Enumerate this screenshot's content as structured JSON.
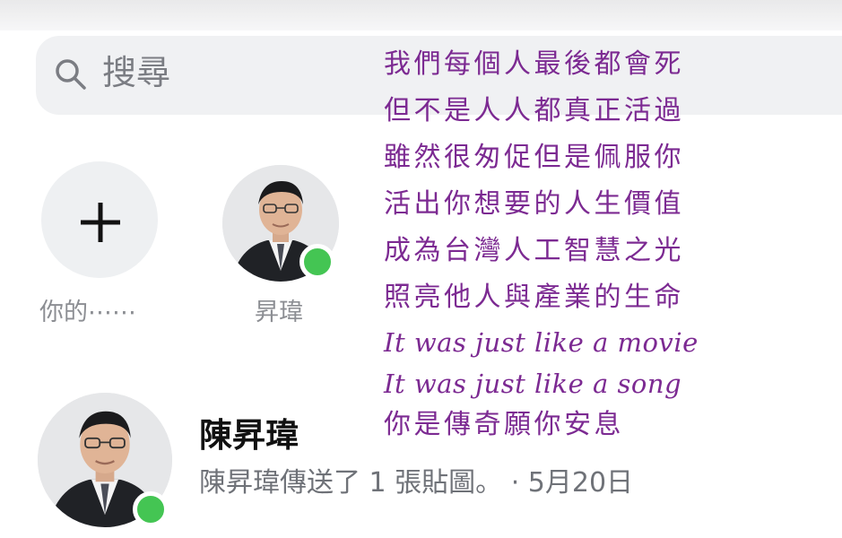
{
  "search": {
    "placeholder": "搜尋",
    "icon": "search-icon"
  },
  "stories": [
    {
      "label": "你的⋯⋯",
      "icon": "plus-icon"
    },
    {
      "label": "昇瑋",
      "online": true
    }
  ],
  "chat": {
    "name": "陳昇瑋",
    "preview": "陳昇瑋傳送了 1 張貼圖。 · 5月20日",
    "online": true
  },
  "poem": {
    "color": "#7c2a92",
    "lines": [
      "我們每個人最後都會死",
      "但不是人人都真正活過",
      "雖然很匆促但是佩服你",
      "活出你想要的人生價值",
      "成為台灣人工智慧之光",
      "照亮他人與產業的生命",
      "It was just like a movie",
      "It was just like a song",
      "你是傳奇願你安息"
    ]
  },
  "colors": {
    "online": "#44c553",
    "search_bg": "#f0f1f3"
  }
}
